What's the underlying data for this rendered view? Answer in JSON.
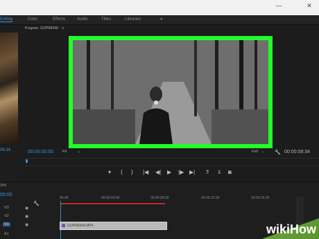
{
  "workspace_tabs": [
    {
      "label": "Editing",
      "active": true
    },
    {
      "label": "Color",
      "active": false
    },
    {
      "label": "Effects",
      "active": false
    },
    {
      "label": "Audio",
      "active": false
    },
    {
      "label": "Titles",
      "active": false
    },
    {
      "label": "Libraries",
      "active": false
    }
  ],
  "more_workspaces_glyph": "»",
  "window_controls": {
    "minimize": "—",
    "close": "✕"
  },
  "left_panel": {
    "timecode": "08:34"
  },
  "program_monitor": {
    "title": "Program: GOPR8349",
    "menu_glyph": "≡",
    "current_time": "00:00:00:00",
    "fit_label": "Fit",
    "quality_label": "Full",
    "duration": "00:00:08:34",
    "highlight_color": "#22ff2a"
  },
  "transport": {
    "marker": "▾",
    "in": "{",
    "out": "}",
    "go_in": "|◀",
    "step_back": "◀|",
    "play": "▶",
    "step_fwd": "|▶",
    "go_out": "▶|",
    "lift": "⇑",
    "extract": "⇓",
    "export_frame": "◙"
  },
  "timeline": {
    "sequence_tab": "349",
    "timecode": "00:00",
    "time_ticks": [
      "00:00",
      "00:00:04:00",
      "00:00:08:00",
      "00:00:12:00",
      "00:00:16:00"
    ],
    "tracks": [
      "V3",
      "V2",
      "V1",
      "A1"
    ],
    "clip_name": "GOPR8349.MP4"
  },
  "watermark": {
    "wiki": "wiki",
    "how": "How"
  },
  "colors": {
    "accent": "#3f8fd2",
    "in_out_bar": "#c8262b",
    "clip": "#b9b9b9"
  }
}
